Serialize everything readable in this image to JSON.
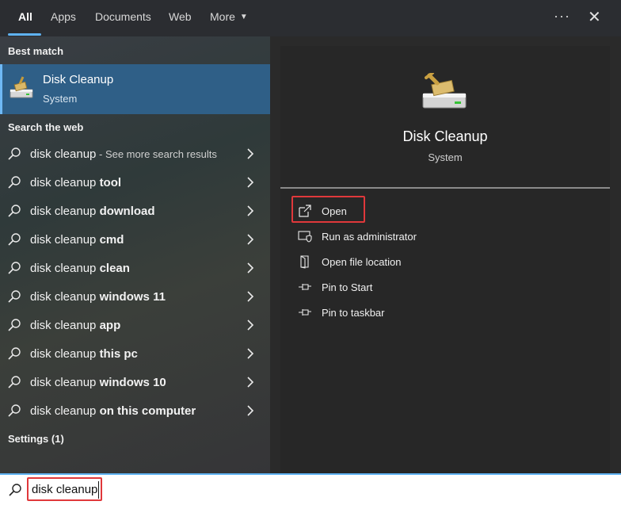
{
  "tabs": [
    {
      "label": "All"
    },
    {
      "label": "Apps"
    },
    {
      "label": "Documents"
    },
    {
      "label": "Web"
    },
    {
      "label": "More"
    }
  ],
  "header": {
    "more_icon": "ellipsis-icon",
    "close_icon": "close-icon"
  },
  "left": {
    "best_match_title": "Best match",
    "best_match": {
      "title": "Disk Cleanup",
      "subtitle": "System"
    },
    "search_web_title": "Search the web",
    "web_results": [
      {
        "base": "disk cleanup",
        "bold": "",
        "hint": " - See more search results"
      },
      {
        "base": "disk cleanup ",
        "bold": "tool",
        "hint": ""
      },
      {
        "base": "disk cleanup ",
        "bold": "download",
        "hint": ""
      },
      {
        "base": "disk cleanup ",
        "bold": "cmd",
        "hint": ""
      },
      {
        "base": "disk cleanup ",
        "bold": "clean",
        "hint": ""
      },
      {
        "base": "disk cleanup ",
        "bold": "windows 11",
        "hint": ""
      },
      {
        "base": "disk cleanup ",
        "bold": "app",
        "hint": ""
      },
      {
        "base": "disk cleanup ",
        "bold": "this pc",
        "hint": ""
      },
      {
        "base": "disk cleanup ",
        "bold": "windows 10",
        "hint": ""
      },
      {
        "base": "disk cleanup ",
        "bold": "on this computer",
        "hint": ""
      }
    ],
    "settings_title": "Settings (1)"
  },
  "right": {
    "app_title": "Disk Cleanup",
    "app_subtitle": "System",
    "actions": [
      {
        "label": "Open",
        "icon": "open-icon"
      },
      {
        "label": "Run as administrator",
        "icon": "shield-icon"
      },
      {
        "label": "Open file location",
        "icon": "file-location-icon"
      },
      {
        "label": "Pin to Start",
        "icon": "pin-icon"
      },
      {
        "label": "Pin to taskbar",
        "icon": "pin-icon"
      }
    ]
  },
  "search": {
    "value": "disk cleanup"
  },
  "colors": {
    "accent": "#5fb2f2",
    "selection": "#2f5f87",
    "highlight": "#e0383b"
  }
}
